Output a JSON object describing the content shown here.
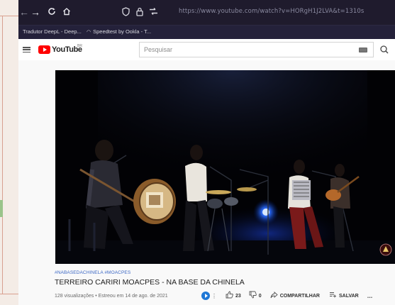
{
  "browser": {
    "url": "https://www.youtube.com/watch?v=HORgH1J2LVA&t=1310s",
    "bookmarks": [
      "Tradutor DeepL - Deep...",
      "Speedtest by Ookla - T..."
    ]
  },
  "youtube": {
    "logo_text": "YouTube",
    "country": "BR",
    "search_placeholder": "Pesquisar"
  },
  "video": {
    "hashtags": "#NABASEDACHINELA #MOACPES",
    "title": "TERREIRO CARIRI MOACPES - NA BASE DA CHINELA",
    "meta": "128 visualizações • Estreou em 14 de ago. de 2021",
    "likes": "23",
    "dislikes": "0",
    "share_label": "COMPARTILHAR",
    "save_label": "SALVAR",
    "more_label": "..."
  },
  "colors": {
    "titlebar": "#1f1b2d",
    "youtube_red": "#ff0000",
    "hashtag_blue": "#3a66c4",
    "stage_blue": "#2a7bff"
  }
}
